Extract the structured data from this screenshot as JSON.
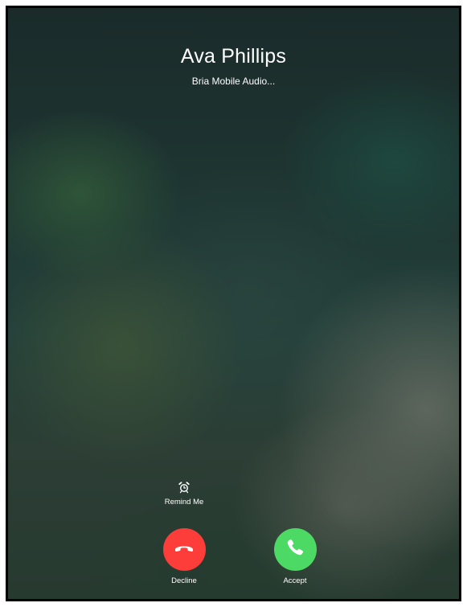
{
  "call": {
    "caller_name": "Ava Phillips",
    "subtitle": "Bria Mobile Audio..."
  },
  "actions": {
    "remind_label": "Remind Me",
    "remind_icon": "alarm-clock-icon",
    "decline_label": "Decline",
    "decline_icon": "phone-hangup-icon",
    "accept_label": "Accept",
    "accept_icon": "phone-icon"
  },
  "colors": {
    "decline": "#fc3d39",
    "accept": "#4cd964",
    "text": "#ffffff"
  }
}
